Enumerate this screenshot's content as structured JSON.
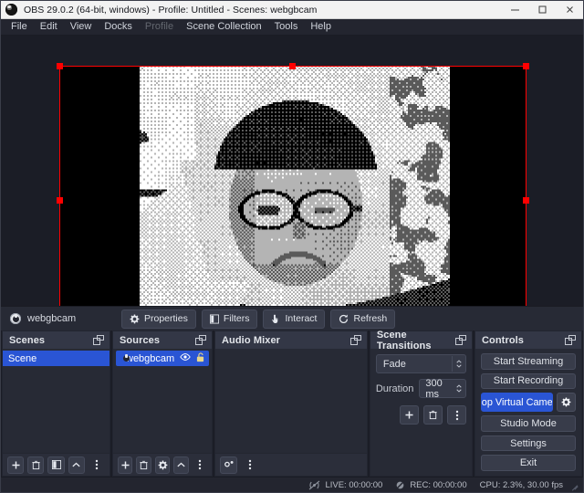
{
  "window": {
    "title": "OBS 29.0.2 (64-bit, windows) - Profile: Untitled - Scenes: webgbcam",
    "app_icon": "obs-logo-icon",
    "minimize_label": "–",
    "maximize_label": "☐",
    "close_label": "✕"
  },
  "menu": {
    "items": [
      {
        "label": "File",
        "disabled": false
      },
      {
        "label": "Edit",
        "disabled": false
      },
      {
        "label": "View",
        "disabled": false
      },
      {
        "label": "Docks",
        "disabled": false
      },
      {
        "label": "Profile",
        "disabled": true
      },
      {
        "label": "Scene Collection",
        "disabled": false
      },
      {
        "label": "Tools",
        "disabled": false
      },
      {
        "label": "Help",
        "disabled": false
      }
    ]
  },
  "preview": {
    "description": "webcam preview rendered as 4-tone dithered gameboy-style image of a person wearing glasses",
    "selection_color": "#ff0000",
    "canvas_background": "#000000"
  },
  "source_toolbar": {
    "source_name": "webgbcam",
    "source_icon": "camera-icon",
    "buttons": [
      {
        "label": "Properties",
        "icon": "gear-icon"
      },
      {
        "label": "Filters",
        "icon": "filters-icon"
      },
      {
        "label": "Interact",
        "icon": "hand-pointer-icon"
      },
      {
        "label": "Refresh",
        "icon": "refresh-icon"
      }
    ]
  },
  "scenes_dock": {
    "title": "Scenes",
    "float_icon": "float-dock-icon",
    "items": [
      {
        "label": "Scene",
        "selected": true
      }
    ],
    "footer_buttons": [
      {
        "icon": "plus-icon",
        "name": "add-scene-button"
      },
      {
        "icon": "trash-icon",
        "name": "remove-scene-button"
      },
      {
        "icon": "scene-filters-icon",
        "name": "scene-filters-button"
      },
      {
        "icon": "chevron-up-icon",
        "name": "move-scene-up-button"
      },
      {
        "icon": "kebab-icon",
        "name": "scene-options-button"
      }
    ]
  },
  "sources_dock": {
    "title": "Sources",
    "float_icon": "float-dock-icon",
    "items": [
      {
        "label": "webgbcam",
        "icon": "camera-icon",
        "visible": true,
        "locked": false,
        "visibility_icon": "eye-icon",
        "lock_icon": "unlocked-padlock-icon",
        "selected": true
      }
    ],
    "footer_buttons": [
      {
        "icon": "plus-icon",
        "name": "add-source-button"
      },
      {
        "icon": "trash-icon",
        "name": "remove-source-button"
      },
      {
        "icon": "gear-icon",
        "name": "source-properties-button"
      },
      {
        "icon": "chevron-up-icon",
        "name": "move-source-up-button"
      },
      {
        "icon": "kebab-icon",
        "name": "source-options-button"
      }
    ]
  },
  "audio_mixer_dock": {
    "title": "Audio Mixer",
    "float_icon": "float-dock-icon",
    "channels": [],
    "footer_buttons": [
      {
        "icon": "audio-settings-icon",
        "name": "audio-advanced-properties-button"
      },
      {
        "icon": "kebab-icon",
        "name": "audio-options-button"
      }
    ]
  },
  "scene_transitions_dock": {
    "title": "Scene Transitions",
    "float_icon": "float-dock-icon",
    "transition_value": "Fade",
    "duration_label": "Duration",
    "duration_value": "300 ms",
    "buttons": [
      {
        "icon": "plus-icon",
        "name": "add-transition-button"
      },
      {
        "icon": "trash-icon",
        "name": "remove-transition-button"
      },
      {
        "icon": "kebab-icon",
        "name": "transition-options-button"
      }
    ]
  },
  "controls_dock": {
    "title": "Controls",
    "float_icon": "float-dock-icon",
    "buttons": [
      {
        "label": "Start Streaming",
        "name": "start-streaming-button",
        "active": false
      },
      {
        "label": "Start Recording",
        "name": "start-recording-button",
        "active": false
      }
    ],
    "virtual_camera": {
      "label": "Stop Virtual Camera",
      "active": true,
      "accent_color": "#2a55d4",
      "settings_icon": "gear-icon"
    },
    "lower_buttons": [
      {
        "label": "Studio Mode",
        "name": "studio-mode-button"
      },
      {
        "label": "Settings",
        "name": "settings-button"
      },
      {
        "label": "Exit",
        "name": "exit-button"
      }
    ]
  },
  "status_bar": {
    "live_icon": "broadcast-off-icon",
    "live_label": "LIVE: 00:00:00",
    "rec_icon": "record-off-icon",
    "rec_label": "REC: 00:00:00",
    "cpu_label": "CPU: 2.3%, 30.00 fps",
    "resize_grip": "resize-grip-icon"
  }
}
